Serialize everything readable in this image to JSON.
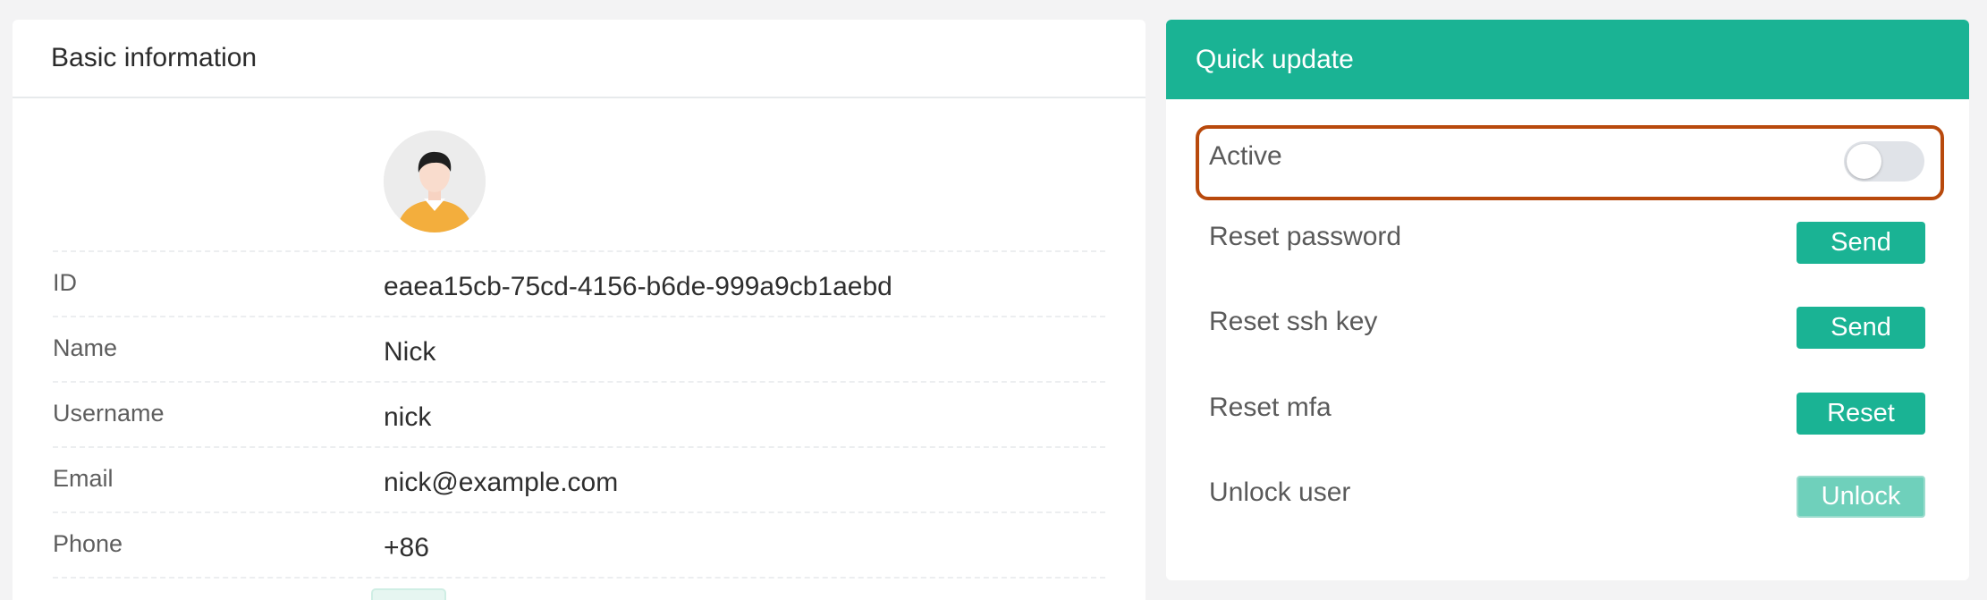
{
  "basic": {
    "title": "Basic information",
    "fields": [
      {
        "label": "ID",
        "value": "eaea15cb-75cd-4156-b6de-999a9cb1aebd"
      },
      {
        "label": "Name",
        "value": "Nick"
      },
      {
        "label": "Username",
        "value": "nick"
      },
      {
        "label": "Email",
        "value": "nick@example.com"
      },
      {
        "label": "Phone",
        "value": "+86"
      }
    ]
  },
  "quick": {
    "title": "Quick update",
    "active_label": "Active",
    "active_on": false,
    "actions": [
      {
        "label": "Reset password",
        "button": "Send"
      },
      {
        "label": "Reset ssh key",
        "button": "Send"
      },
      {
        "label": "Reset mfa",
        "button": "Reset"
      },
      {
        "label": "Unlock user",
        "button": "Unlock"
      }
    ]
  },
  "colors": {
    "accent": "#1ab394",
    "highlight_border": "#b8490c",
    "disabled_button": "#6fd0bb"
  }
}
